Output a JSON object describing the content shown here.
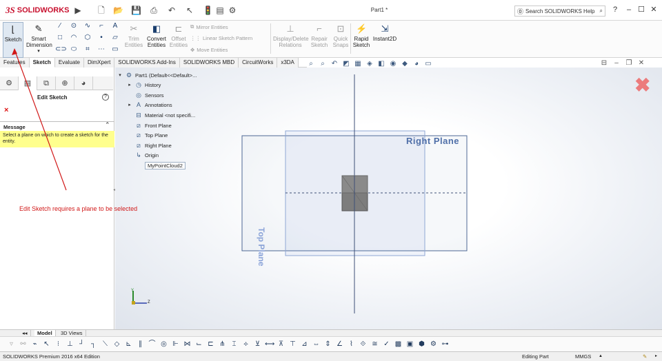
{
  "titlebar": {
    "logo_ds": "3S",
    "logo_text": "SOLIDWORKS",
    "doc_title": "Part1 *",
    "search_placeholder": "Search SOLIDWORKS Help",
    "help_label": "?",
    "quick_access": [
      "new-icon",
      "open-icon",
      "save-icon",
      "print-icon",
      "undo-icon",
      "select-icon",
      "rebuild-icon",
      "file-properties-icon",
      "options-icon"
    ]
  },
  "commands": {
    "sketch": "Sketch",
    "smart_dimension": "Smart Dimension",
    "trim_entities": "Trim Entities",
    "convert_entities": "Convert Entities",
    "offset_entities": "Offset Entities",
    "mirror_entities": "Mirror Entities",
    "linear_sketch_pattern": "Linear Sketch Pattern",
    "move_entities": "Move Entities",
    "display_delete_relations": "Display/Delete Relations",
    "repair_sketch": "Repair Sketch",
    "quick_snaps": "Quick Snaps",
    "rapid_sketch": "Rapid Sketch",
    "instant2d": "Instant2D"
  },
  "tabs": [
    "Features",
    "Sketch",
    "Evaluate",
    "DimXpert",
    "SOLIDWORKS Add-Ins",
    "SOLIDWORKS MBD",
    "CircuitWorks",
    "x3DA"
  ],
  "active_tab": "Sketch",
  "property_manager": {
    "title": "Edit Sketch",
    "help": "?",
    "close": "×",
    "message_header": "Message",
    "message": "Select a plane on which to create a sketch for the entity."
  },
  "tree": {
    "root": "Part1  (Default<<Default>...",
    "items": [
      "History",
      "Sensors",
      "Annotations",
      "Material <not specifi...",
      "Front Plane",
      "Top Plane",
      "Right Plane",
      "Origin",
      "MyPointCloud2"
    ]
  },
  "viewport": {
    "right_plane_label": "Right Plane",
    "top_plane_label": "Top Plane",
    "axis_y": "Y",
    "axis_z": "Z"
  },
  "annotation": "Edit Sketch requires a plane to be selected",
  "model_tabs": [
    "Model",
    "3D Views"
  ],
  "status": {
    "edition": "SOLIDWORKS Premium 2016 x64 Edition",
    "mode": "Editing Part",
    "units": "MMGS"
  },
  "colors": {
    "brand_red": "#c8102e",
    "message_bg": "#ffff8d",
    "annotation_red": "#d11818",
    "plane_blue": "#4f6fa8"
  }
}
